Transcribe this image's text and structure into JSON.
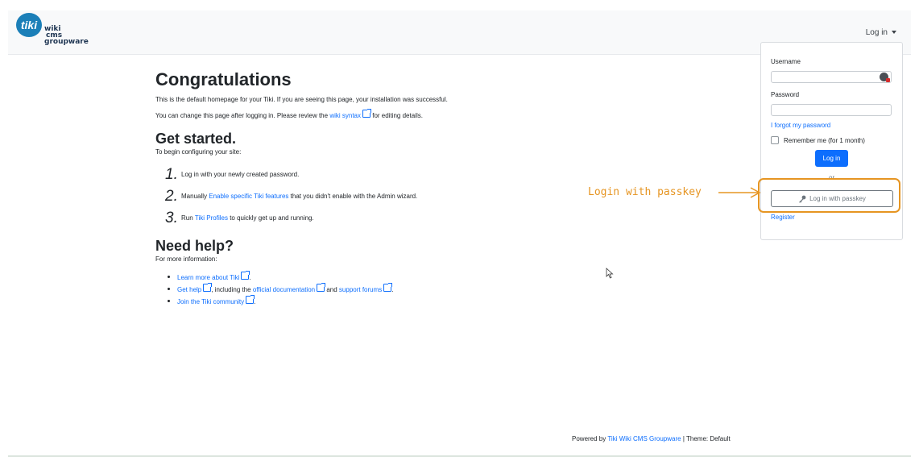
{
  "header": {
    "logo": {
      "badge": "tiki",
      "line1": "wiki",
      "line2": "cms",
      "line3": "groupware"
    },
    "login_toggle": "Log in"
  },
  "main": {
    "title": "Congratulations",
    "intro": "This is the default homepage for your Tiki. If you are seeing this page, your installation was successful.",
    "change_prefix": "You can change this page after logging in. Please review the",
    "change_link": "wiki syntax",
    "change_suffix": "for editing details.",
    "get_started": {
      "heading": "Get started.",
      "intro": "To begin configuring your site:",
      "steps": [
        {
          "num": "1.",
          "text": "Log in with your newly created password."
        },
        {
          "num": "2.",
          "prefix": "Manually",
          "link": "Enable specific Tiki features",
          "suffix": "that you didn't enable with the Admin wizard."
        },
        {
          "num": "3.",
          "prefix": "Run",
          "link": "Tiki Profiles",
          "suffix": "to quickly get up and running."
        }
      ]
    },
    "help": {
      "heading": "Need help?",
      "intro": "For more information:",
      "items": [
        {
          "link": "Learn more about Tiki",
          "suffix": "."
        },
        {
          "link": "Get help",
          "mid": ", including the",
          "link2": "official documentation",
          "mid2": "and",
          "link3": "support forums",
          "suffix": "."
        },
        {
          "link": "Join the Tiki community",
          "suffix": "."
        }
      ]
    }
  },
  "login_panel": {
    "username_label": "Username",
    "password_label": "Password",
    "forgot_link": "I forgot my password",
    "remember_label": "Remember me (for 1 month)",
    "login_button": "Log in",
    "or_text": "or",
    "passkey_button": "Log in with passkey",
    "register_link": "Register"
  },
  "annotation": {
    "text": "Login with passkey",
    "color": "#e69522"
  },
  "footer": {
    "prefix": "Powered by",
    "link": "Tiki Wiki CMS Groupware",
    "suffix": "| Theme: Default"
  },
  "colors": {
    "link": "#0d6efd",
    "primary_button": "#0d6efd",
    "annotation": "#e69522"
  }
}
